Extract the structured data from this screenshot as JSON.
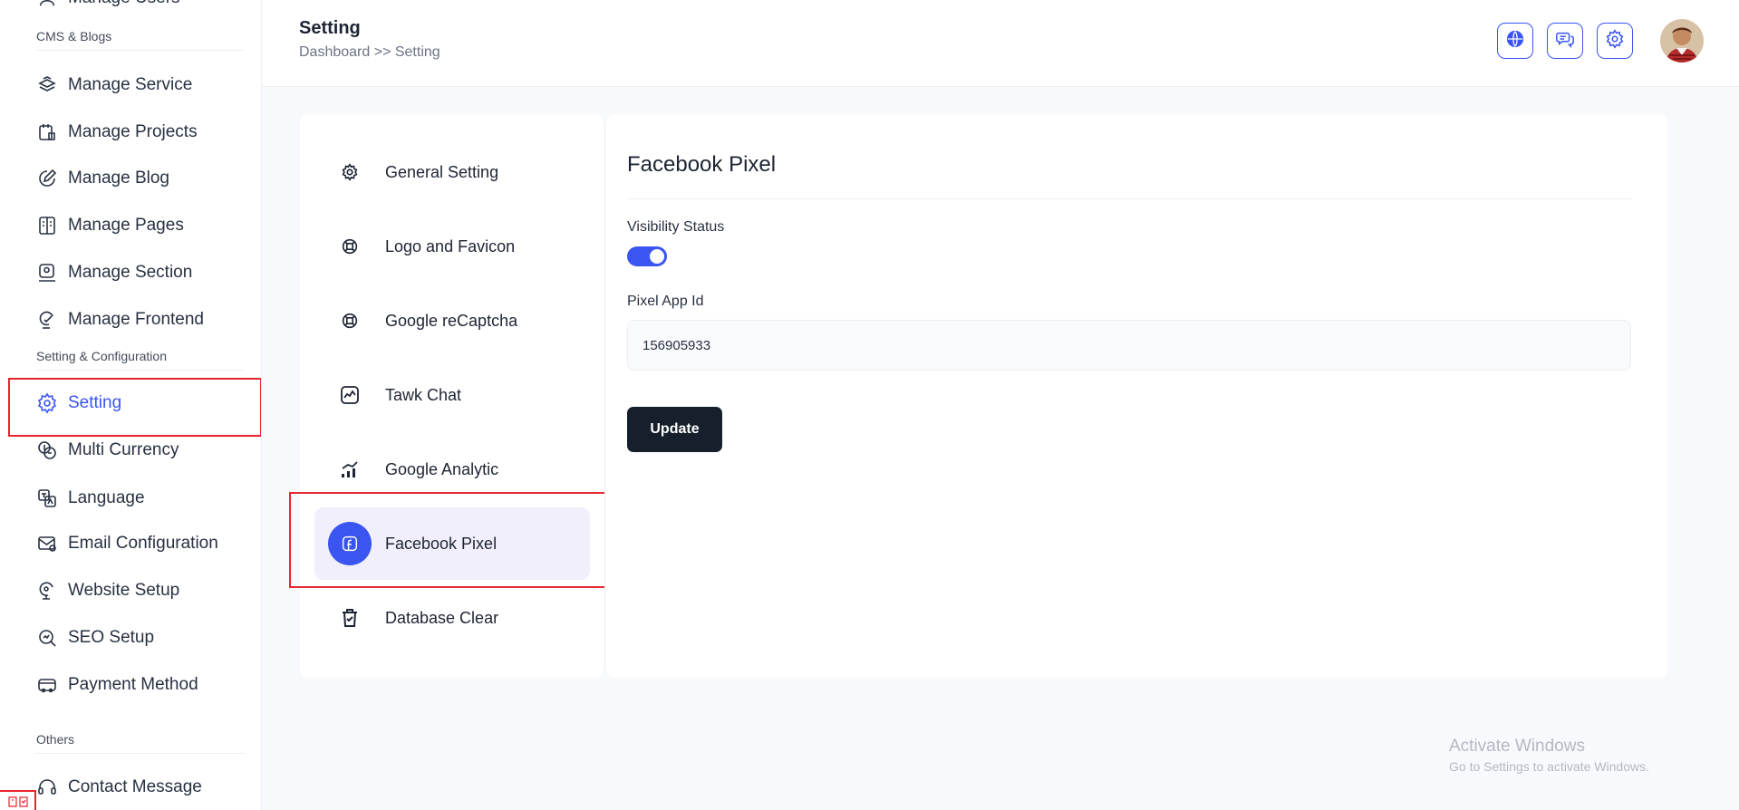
{
  "sidebar": {
    "top_cut_item": "Manage Users",
    "sections": {
      "cms": "CMS & Blogs",
      "setting": "Setting & Configuration",
      "others": "Others"
    },
    "items": [
      {
        "label": "Manage Service",
        "icon": "service-icon"
      },
      {
        "label": "Manage Projects",
        "icon": "projects-icon"
      },
      {
        "label": "Manage Blog",
        "icon": "blog-icon"
      },
      {
        "label": "Manage Pages",
        "icon": "pages-icon"
      },
      {
        "label": "Manage Section",
        "icon": "section-icon"
      },
      {
        "label": "Manage Frontend",
        "icon": "frontend-icon"
      },
      {
        "label": "Setting",
        "icon": "gear-icon",
        "active": true
      },
      {
        "label": "Multi Currency",
        "icon": "currency-icon"
      },
      {
        "label": "Language",
        "icon": "language-icon"
      },
      {
        "label": "Email Configuration",
        "icon": "email-config-icon"
      },
      {
        "label": "Website Setup",
        "icon": "website-setup-icon"
      },
      {
        "label": "SEO Setup",
        "icon": "seo-icon"
      },
      {
        "label": "Payment Method",
        "icon": "payment-icon"
      },
      {
        "label": "Contact Message",
        "icon": "headset-icon"
      }
    ]
  },
  "header": {
    "title": "Setting",
    "breadcrumb": "Dashboard >> Setting",
    "buttons": [
      "globe-icon",
      "chat-icon",
      "gear-icon"
    ],
    "avatar": "user-avatar"
  },
  "settings_menu": {
    "items": [
      {
        "label": "General Setting",
        "icon": "gear-icon"
      },
      {
        "label": "Logo and Favicon",
        "icon": "logo-icon"
      },
      {
        "label": "Google reCaptcha",
        "icon": "recaptcha-icon"
      },
      {
        "label": "Tawk Chat",
        "icon": "tawk-chat-icon"
      },
      {
        "label": "Google Analytic",
        "icon": "analytics-icon"
      },
      {
        "label": "Facebook Pixel",
        "icon": "facebook-icon",
        "active": true
      },
      {
        "label": "Database Clear",
        "icon": "trash-icon"
      }
    ]
  },
  "content": {
    "title": "Facebook Pixel",
    "visibility_label": "Visibility Status",
    "visibility_on": true,
    "pixel_label": "Pixel App Id",
    "pixel_value": "156905933",
    "update_label": "Update"
  },
  "watermark": {
    "title": "Activate Windows",
    "subtitle": "Go to Settings to activate Windows."
  },
  "colors": {
    "accent": "#3a55f0",
    "highlight_frame": "#e8242e",
    "dark_button": "#16202c",
    "active_menu_bg": "#f1effc"
  }
}
